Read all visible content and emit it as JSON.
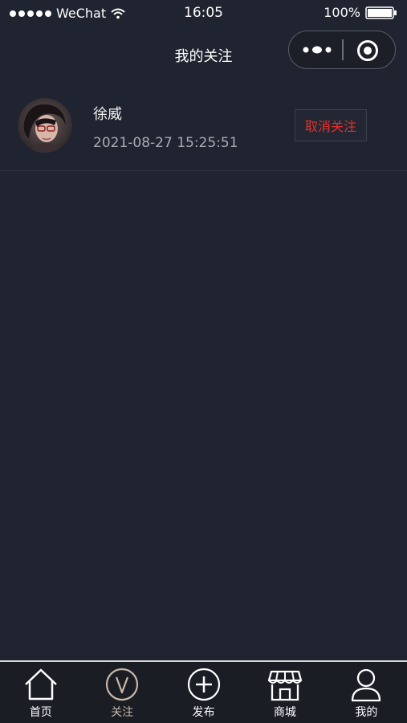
{
  "status_bar": {
    "carrier": "WeChat",
    "time": "16:05",
    "battery": "100%"
  },
  "nav": {
    "title": "我的关注",
    "capsule_icons": [
      "more-icon",
      "close-icon"
    ]
  },
  "follow_list": [
    {
      "name": "徐威",
      "time": "2021-08-27 15:25:51",
      "action_label": "取消关注"
    }
  ],
  "tab_bar": {
    "items": [
      {
        "label": "首页",
        "icon": "home-icon",
        "active": false
      },
      {
        "label": "关注",
        "icon": "v-circle-icon",
        "active": true
      },
      {
        "label": "发布",
        "icon": "plus-circle-icon",
        "active": false
      },
      {
        "label": "商城",
        "icon": "store-icon",
        "active": false
      },
      {
        "label": "我的",
        "icon": "user-icon",
        "active": false
      }
    ]
  },
  "colors": {
    "background": "#202430",
    "unfollow_text": "#e0322f",
    "active_tab": "#c8b8a8"
  }
}
